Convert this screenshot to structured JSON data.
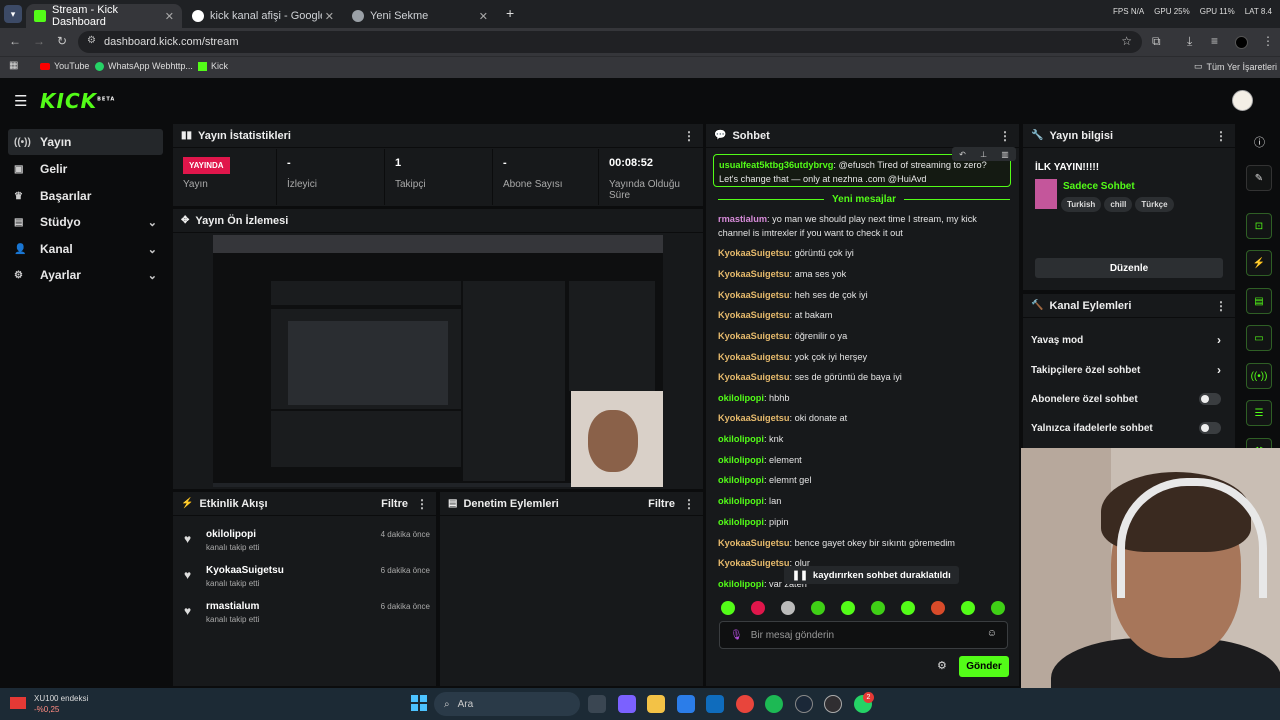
{
  "browser": {
    "tabs": [
      {
        "title": "Stream - Kick Dashboard"
      },
      {
        "title": "kick kanal afişi - Google'da Ara"
      },
      {
        "title": "Yeni Sekme"
      }
    ],
    "perf": {
      "fps": "FPS N/A",
      "gpu": "GPU 25%",
      "gpu2": "GPU 11%",
      "lat": "LAT 8.4"
    },
    "url": "dashboard.kick.com/stream",
    "bookmarks": [
      "YouTube",
      "WhatsApp Webhttp...",
      "Kick"
    ],
    "all_bookmarks": "Tüm Yer İşaretleri"
  },
  "app": {
    "logo": "KICK",
    "logo_sup": "BETA",
    "nav": [
      {
        "label": "Yayın"
      },
      {
        "label": "Gelir"
      },
      {
        "label": "Başarılar"
      },
      {
        "label": "Stüdyo"
      },
      {
        "label": "Kanal"
      },
      {
        "label": "Ayarlar"
      }
    ]
  },
  "stats": {
    "title": "Yayın İstatistikleri",
    "live_badge": "YAYINDA",
    "status_label": "Yayın",
    "items": [
      {
        "value": "-",
        "label": "İzleyici"
      },
      {
        "value": "1",
        "label": "Takipçi"
      },
      {
        "value": "-",
        "label": "Abone Sayısı"
      },
      {
        "value": "00:08:52",
        "label": "Yayında Olduğu Süre"
      }
    ]
  },
  "preview": {
    "title": "Yayın Ön İzlemesi"
  },
  "events": {
    "title": "Etkinlik Akışı",
    "filter": "Filtre",
    "items": [
      {
        "name": "okilolipopi",
        "sub": "kanalı takip etti",
        "time": "4 dakika önce"
      },
      {
        "name": "KyokaaSuigetsu",
        "sub": "kanalı takip etti",
        "time": "6 dakika önce"
      },
      {
        "name": "rmastialum",
        "sub": "kanalı takip etti",
        "time": "6 dakika önce"
      }
    ]
  },
  "moderation": {
    "title": "Denetim Eylemleri",
    "filter": "Filtre"
  },
  "chat": {
    "title": "Sohbet",
    "pinned": {
      "user": "usualfeat5ktbg36utdybrvg",
      "text": ": @efusch Tired of streaming to zero? Let's change that — only at nezhna .com @HuiAvd"
    },
    "new_messages": "Yeni mesajlar",
    "messages": [
      {
        "user": "rmastialum",
        "text": ": yo man we should play next time I stream, my kick channel is imtrexler if you want to check it out"
      },
      {
        "user": "KyokaaSuigetsu",
        "text": ": görüntü çok iyi"
      },
      {
        "user": "KyokaaSuigetsu",
        "text": ": ama ses yok"
      },
      {
        "user": "KyokaaSuigetsu",
        "text": ": heh ses de çok iyi"
      },
      {
        "user": "KyokaaSuigetsu",
        "text": ": at bakam"
      },
      {
        "user": "KyokaaSuigetsu",
        "text": ": öğrenilir o ya"
      },
      {
        "user": "KyokaaSuigetsu",
        "text": ": yok çok iyi herşey"
      },
      {
        "user": "KyokaaSuigetsu",
        "text": ": ses de görüntü de baya iyi"
      },
      {
        "user": "okilolipopi",
        "text": ": hbhb"
      },
      {
        "user": "KyokaaSuigetsu",
        "text": ": oki donate at"
      },
      {
        "user": "okilolipopi",
        "text": ": knk"
      },
      {
        "user": "okilolipopi",
        "text": ": element"
      },
      {
        "user": "okilolipopi",
        "text": ": elemnt gel"
      },
      {
        "user": "okilolipopi",
        "text": ": lan"
      },
      {
        "user": "okilolipopi",
        "text": ": pipin"
      },
      {
        "user": "KyokaaSuigetsu",
        "text": ": bence gayet okey bir sıkıntı göremedim"
      },
      {
        "user": "KyokaaSuigetsu",
        "text": ": olur"
      },
      {
        "user": "okilolipopi",
        "text": ": var zaten"
      }
    ],
    "paused": "kaydırırken sohbet duraklatıldı",
    "input_placeholder": "Bir mesaj gönderin",
    "send": "Gönder"
  },
  "stream_info": {
    "title": "Yayın bilgisi",
    "stream_title": "İLK YAYIN!!!!!",
    "category": "Sadece Sohbet",
    "tags": [
      "Turkish",
      "chill",
      "Türkçe"
    ],
    "edit": "Düzenle"
  },
  "channel_actions": {
    "title": "Kanal Eylemleri",
    "items": [
      "Yavaş mod",
      "Takipçilere özel sohbet",
      "Abonelere özel sohbet",
      "Yalnızca ifadelerle sohbet"
    ]
  },
  "taskbar": {
    "stock_name": "XU100 endeksi",
    "stock_change": "-%0,25",
    "search": "Ara",
    "badge": "2"
  },
  "colors": {
    "accent": "#53fc18",
    "live": "#e0164b",
    "panel": "#17191b"
  }
}
